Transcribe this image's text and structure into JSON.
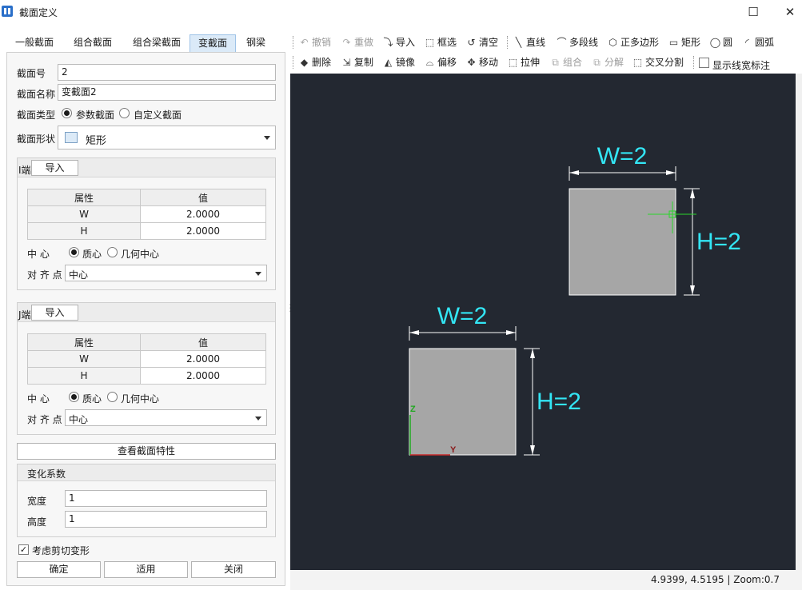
{
  "window": {
    "title": "截面定义",
    "maximize_symbol": "☐",
    "close_symbol": "✕"
  },
  "tabs": [
    {
      "label": "一般截面"
    },
    {
      "label": "组合截面"
    },
    {
      "label": "组合梁截面"
    },
    {
      "label": "变截面",
      "active": true
    },
    {
      "label": "钢梁"
    }
  ],
  "form": {
    "section_no_label": "截面号",
    "section_no_value": "2",
    "section_name_label": "截面名称",
    "section_name_value": "变截面2",
    "section_type_label": "截面类型",
    "section_type_options": [
      "参数截面",
      "自定义截面"
    ],
    "section_type_selected": "参数截面",
    "section_shape_label": "截面形状",
    "section_shape_value": "矩形"
  },
  "i_end": {
    "label": "I端",
    "import_label": "导入",
    "table_headers": [
      "属性",
      "值"
    ],
    "rows": [
      {
        "name": "W",
        "value": "2.0000"
      },
      {
        "name": "H",
        "value": "2.0000"
      }
    ],
    "center_label": "中 心",
    "center_options": [
      "质心",
      "几何中心"
    ],
    "center_selected": "质心",
    "align_label": "对 齐 点",
    "align_value": "中心"
  },
  "j_end": {
    "label": "J端",
    "import_label": "导入",
    "table_headers": [
      "属性",
      "值"
    ],
    "rows": [
      {
        "name": "W",
        "value": "2.0000"
      },
      {
        "name": "H",
        "value": "2.0000"
      }
    ],
    "center_label": "中 心",
    "center_options": [
      "质心",
      "几何中心"
    ],
    "center_selected": "质心",
    "align_label": "对 齐 点",
    "align_value": "中心"
  },
  "view_properties_label": "查看截面特性",
  "variation": {
    "label": "变化系数",
    "width_label": "宽度",
    "width_value": "1",
    "height_label": "高度",
    "height_value": "1"
  },
  "shear_checkbox": {
    "label": "考虑剪切变形",
    "checked": true
  },
  "buttons": {
    "ok": "确定",
    "apply": "适用",
    "close": "关闭"
  },
  "toolbar_row1": [
    {
      "label": "撤销",
      "icon": "undo-icon",
      "glyph": "↶",
      "disabled": true
    },
    {
      "label": "重做",
      "icon": "redo-icon",
      "glyph": "↷",
      "disabled": true
    },
    {
      "label": "导入",
      "icon": "import-icon",
      "glyph": "⤵"
    },
    {
      "label": "框选",
      "icon": "box-select-icon",
      "glyph": "⬚"
    },
    {
      "label": "清空",
      "icon": "clear-icon",
      "glyph": "↺"
    },
    {
      "label": "直线",
      "icon": "line-icon",
      "glyph": "╲"
    },
    {
      "label": "多段线",
      "icon": "polyline-icon",
      "glyph": "⌒"
    },
    {
      "label": "正多边形",
      "icon": "polygon-icon",
      "glyph": "⬡"
    },
    {
      "label": "矩形",
      "icon": "rectangle-icon",
      "glyph": "▭"
    },
    {
      "label": "圆",
      "icon": "circle-icon",
      "glyph": "◯"
    },
    {
      "label": "圆弧",
      "icon": "arc-icon",
      "glyph": "◜"
    }
  ],
  "toolbar_row2": [
    {
      "label": "删除",
      "icon": "eraser-icon",
      "glyph": "◆"
    },
    {
      "label": "复制",
      "icon": "copy-icon",
      "glyph": "⇲"
    },
    {
      "label": "镜像",
      "icon": "mirror-icon",
      "glyph": "◭"
    },
    {
      "label": "偏移",
      "icon": "offset-icon",
      "glyph": "⌓"
    },
    {
      "label": "移动",
      "icon": "move-icon",
      "glyph": "✥"
    },
    {
      "label": "拉伸",
      "icon": "stretch-icon",
      "glyph": "⬚"
    },
    {
      "label": "组合",
      "icon": "group-icon",
      "glyph": "⧉",
      "disabled": true
    },
    {
      "label": "分解",
      "icon": "explode-icon",
      "glyph": "⧉",
      "disabled": true
    },
    {
      "label": "交叉分割",
      "icon": "cross-split-icon",
      "glyph": "⬚"
    }
  ],
  "show_width_annotation": {
    "label": "显示线宽标注",
    "checked": false
  },
  "canvas": {
    "background": "#232831",
    "dim_color": "#33e6f5",
    "section_fill": "#a6a6a6",
    "i_section": {
      "w_label": "W=2",
      "h_label": "H=2"
    },
    "j_section": {
      "w_label": "W=2",
      "h_label": "H=2"
    },
    "axis_z_label": "Z",
    "axis_y_label": "Y"
  },
  "status": {
    "coordinates": "4.9399, 4.5195",
    "zoom": "Zoom:0.7",
    "text": "4.9399, 4.5195 | Zoom:0.7"
  }
}
